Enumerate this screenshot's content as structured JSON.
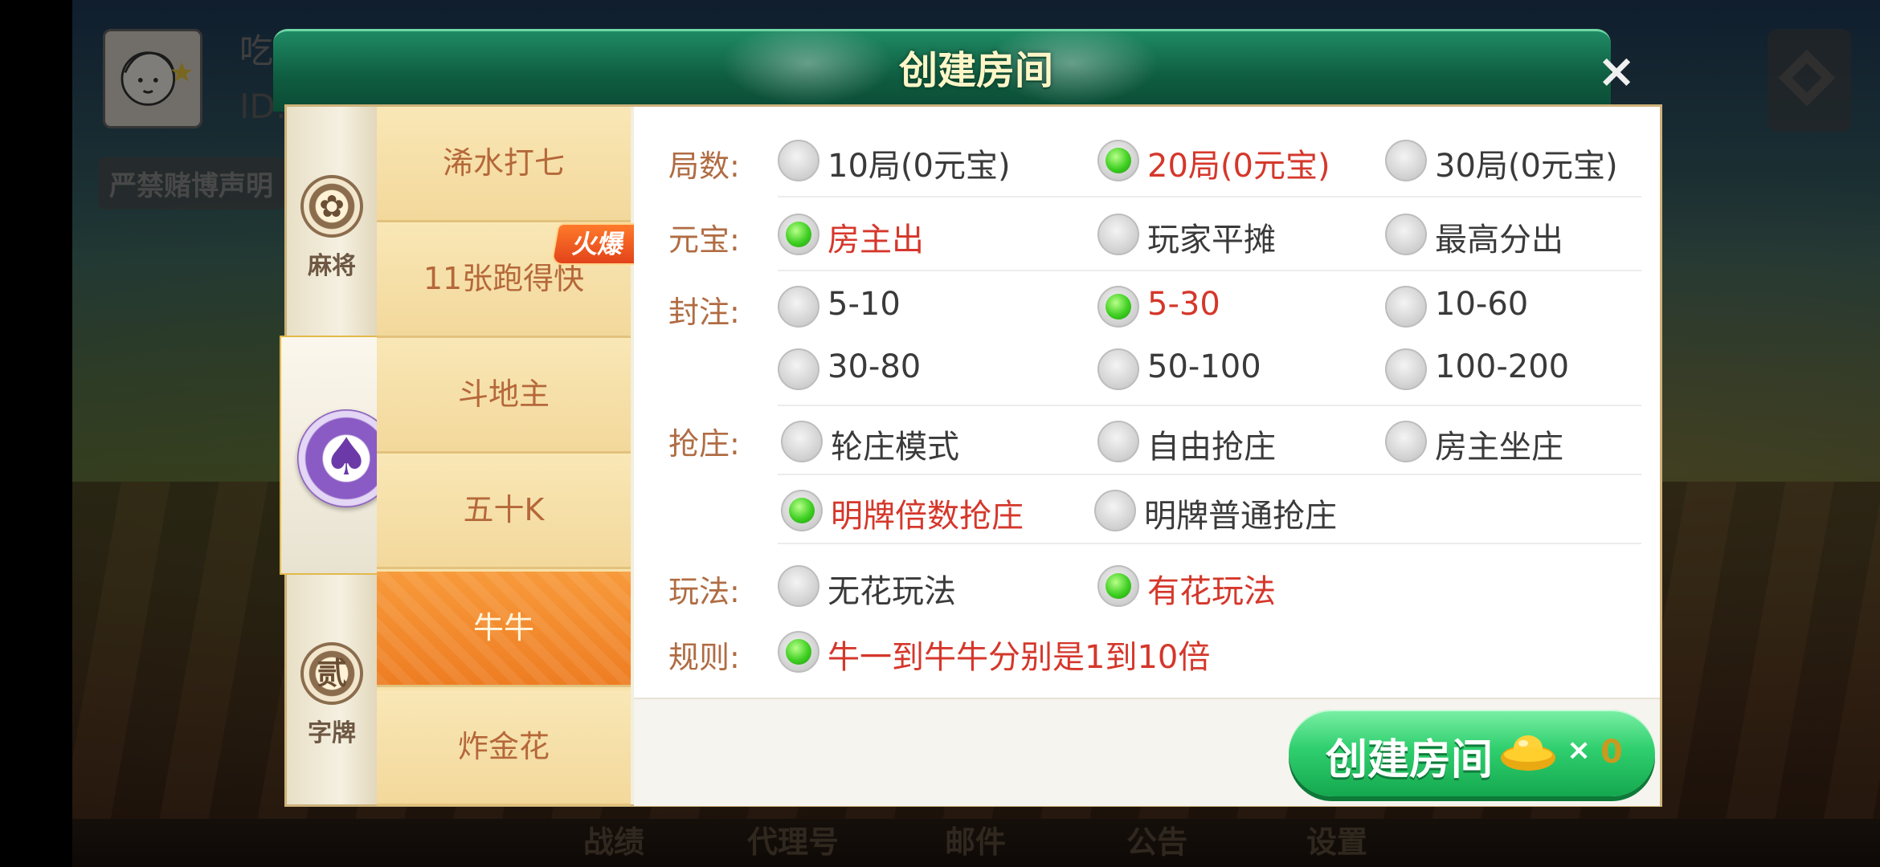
{
  "user": {
    "name": "吃瓜群众",
    "id": "ID:",
    "notice": "严禁赌博声明"
  },
  "dialog": {
    "title": "创建房间",
    "close": "×"
  },
  "categories": [
    {
      "label": "麻将",
      "icon": "flower-emblem-icon"
    },
    {
      "label": "",
      "icon": "spade-chip-icon"
    },
    {
      "label": "字牌",
      "icon_text": "贰",
      "icon": "er-character-icon"
    }
  ],
  "games": [
    {
      "label": "浠水打七"
    },
    {
      "label": "11张跑得快",
      "badge": "火爆"
    },
    {
      "label": "斗地主"
    },
    {
      "label": "五十K"
    },
    {
      "label": "牛牛",
      "active": true
    },
    {
      "label": "炸金花"
    }
  ],
  "rows": {
    "rounds": {
      "label": "局数:",
      "options": [
        "10局(0元宝)",
        "20局(0元宝)",
        "30局(0元宝)"
      ],
      "selected": 1
    },
    "ingot": {
      "label": "元宝:",
      "options": [
        "房主出",
        "玩家平摊",
        "最高分出"
      ],
      "selected": 0
    },
    "cap": {
      "label": "封注:",
      "options": [
        "5-10",
        "5-30",
        "10-60",
        "30-80",
        "50-100",
        "100-200"
      ],
      "selected": 1
    },
    "banker": {
      "label": "抢庄:",
      "options": [
        "轮庄模式",
        "自由抢庄",
        "房主坐庄",
        "明牌倍数抢庄",
        "明牌普通抢庄"
      ],
      "selected": 3
    },
    "play": {
      "label": "玩法:",
      "options": [
        "无花玩法",
        "有花玩法"
      ],
      "selected": 1
    },
    "rule": {
      "label": "规则:",
      "options": [
        "牛一到牛牛分别是1到10倍"
      ],
      "selected": 0
    }
  },
  "create_button": {
    "label": "创建房间",
    "multiplier": "×",
    "count": "0"
  },
  "bottom_nav": [
    "战绩",
    "代理号",
    "邮件",
    "公告",
    "设置"
  ],
  "colors": {
    "header_green": "#0f5e42",
    "selected_text": "#d5372b",
    "label_brown": "#b06c43",
    "active_tab": "#ee7d22",
    "button_green": "#2fcf6e"
  }
}
